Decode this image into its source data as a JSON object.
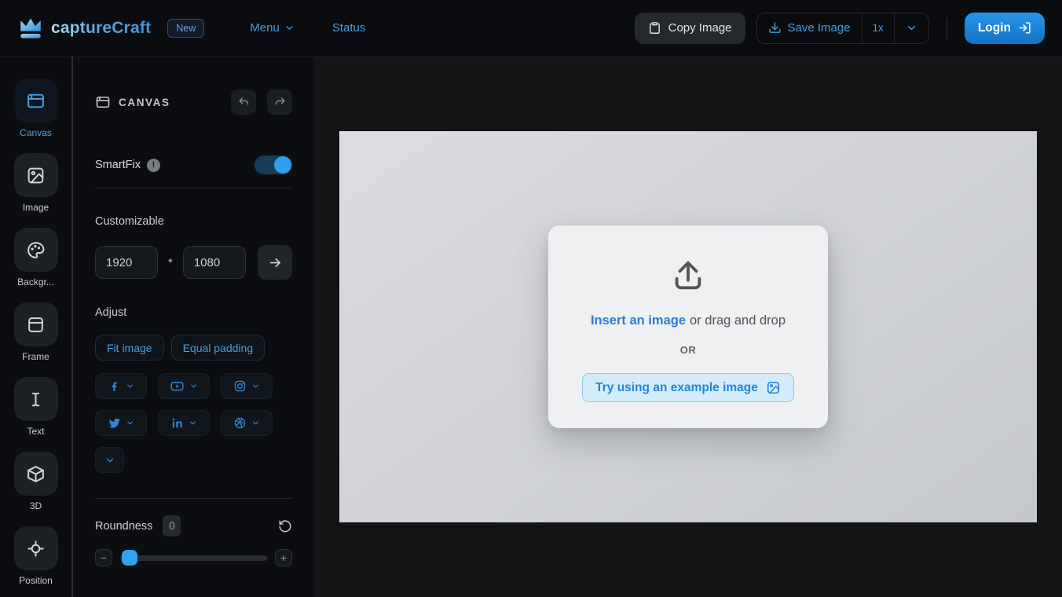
{
  "navbar": {
    "brand": "captureCraft",
    "badge": "New",
    "menu_label": "Menu",
    "status_label": "Status",
    "copy_image_label": "Copy Image",
    "save_image_label": "Save Image",
    "scale_label": "1x",
    "login_label": "Login"
  },
  "sidebar": {
    "items": [
      {
        "label": "Canvas",
        "icon": "browser-window-icon",
        "active": true
      },
      {
        "label": "Image",
        "icon": "image-icon",
        "active": false
      },
      {
        "label": "Backgr...",
        "icon": "palette-icon",
        "active": false
      },
      {
        "label": "Frame",
        "icon": "frame-icon",
        "active": false
      },
      {
        "label": "Text",
        "icon": "text-cursor-icon",
        "active": false
      },
      {
        "label": "3D",
        "icon": "cube-icon",
        "active": false
      },
      {
        "label": "Position",
        "icon": "crosshair-icon",
        "active": false
      }
    ]
  },
  "panel": {
    "title": "CANVAS",
    "smartfix": {
      "label": "SmartFix",
      "enabled": true
    },
    "customizable": {
      "label": "Customizable",
      "width": "1920",
      "separator": "*",
      "height": "1080"
    },
    "adjust": {
      "label": "Adjust",
      "fit_image_label": "Fit image",
      "equal_padding_label": "Equal padding"
    },
    "social_presets": [
      "facebook",
      "youtube",
      "instagram",
      "twitter",
      "linkedin",
      "dribbble",
      "more"
    ],
    "roundness": {
      "label": "Roundness",
      "value": "0"
    }
  },
  "uploader": {
    "insert_link": "Insert an image",
    "drag_text": "or drag and drop",
    "or_text": "OR",
    "example_button_label": "Try using an example image"
  },
  "colors": {
    "accent_blue": "#4b9ade",
    "bright_blue": "#2f9fee",
    "login_bg": "#1b84d7",
    "navbar_bg": "#0a0c0f",
    "panel_bg": "#0b0d11",
    "workspace_bg": "#131416",
    "canvas_gradient_from": "#dbdde0",
    "canvas_gradient_to": "#c5c8cc",
    "card_bg": "#eff0f2",
    "example_button_bg": "#d4ecfa",
    "example_button_border": "#8acbf0",
    "link_blue": "#2b7cd3"
  }
}
